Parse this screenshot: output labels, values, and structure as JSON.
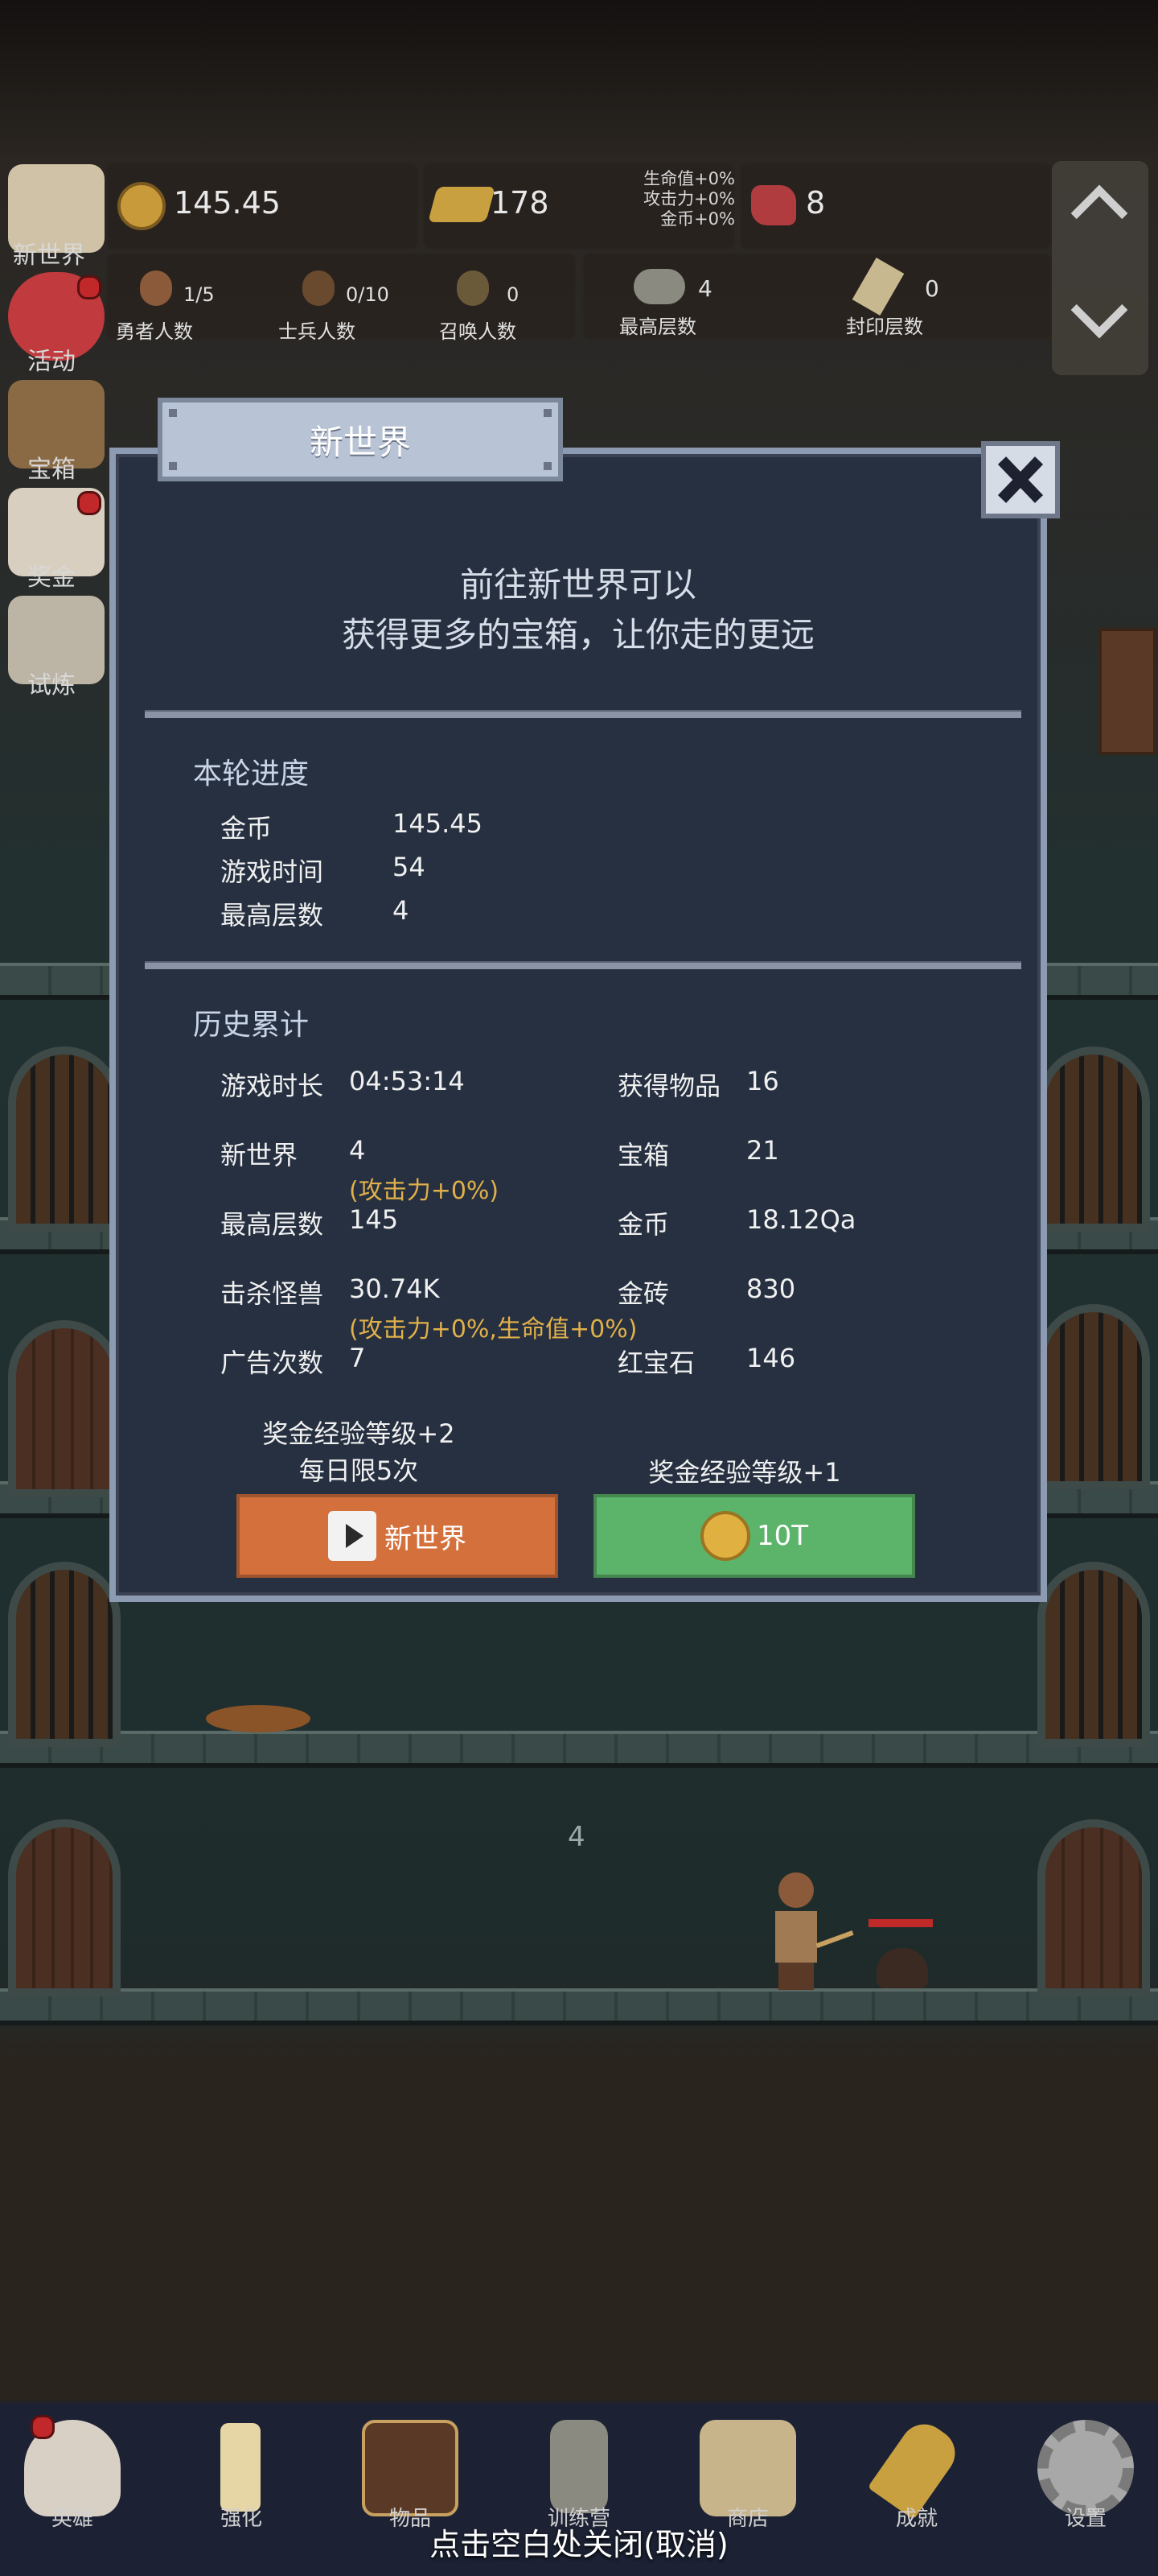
{
  "top": {
    "gold": "145.45",
    "bricks": "178",
    "ruby": "8",
    "buffs": [
      "生命值+0%",
      "攻击力+0%",
      "金币+0%"
    ],
    "heroes_value": "1/5",
    "heroes_label": "勇者人数",
    "soldiers_value": "0/10",
    "soldiers_label": "士兵人数",
    "summons_value": "0",
    "summons_label": "召唤人数",
    "max_floor_value": "4",
    "max_floor_label": "最高层数",
    "seal_floor_value": "0",
    "seal_floor_label": "封印层数"
  },
  "side_menu": [
    "新世界",
    "活动",
    "宝箱",
    "奖金",
    "试炼"
  ],
  "scene": {
    "floor_number": "4"
  },
  "modal": {
    "tab_title": "新世界",
    "intro_line1": "前往新世界可以",
    "intro_line2": "获得更多的宝箱，让你走的更远",
    "round_title": "本轮进度",
    "round": [
      {
        "label": "金币",
        "value": "145.45"
      },
      {
        "label": "游戏时间",
        "value": "54"
      },
      {
        "label": "最高层数",
        "value": "4"
      }
    ],
    "history_title": "历史累计",
    "history": {
      "play_time_label": "游戏时长",
      "play_time": "04:53:14",
      "items_label": "获得物品",
      "items": "16",
      "new_world_label": "新世界",
      "new_world": "4",
      "new_world_bonus": "(攻击力+0%)",
      "chest_label": "宝箱",
      "chest": "21",
      "max_floor_label": "最高层数",
      "max_floor": "145",
      "gold_label": "金币",
      "gold": "18.12Qa",
      "kills_label": "击杀怪兽",
      "kills": "30.74K",
      "kills_bonus": "(攻击力+0%,生命值+0%)",
      "bricks_label": "金砖",
      "bricks": "830",
      "ads_label": "广告次数",
      "ads": "7",
      "ruby_label": "红宝石",
      "ruby": "146"
    },
    "left_note1": "奖金经验等级+2",
    "left_note2": "每日限5次",
    "right_note": "奖金经验等级+1",
    "left_button": "新世界",
    "right_button": "10T",
    "left_button_color": "#d4703c",
    "right_button_color": "#5cb46a"
  },
  "bottom_nav": [
    "英雄",
    "强化",
    "物品",
    "训练营",
    "商店",
    "成就",
    "设置"
  ],
  "close_hint": "点击空白处关闭(取消)"
}
